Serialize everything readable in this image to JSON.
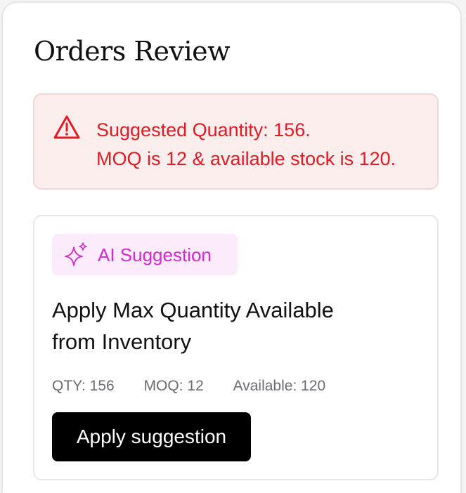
{
  "page": {
    "title": "Orders Review"
  },
  "alert": {
    "icon": "warning-triangle-icon",
    "line1": "Suggested Quantity: 156.",
    "line2": "MOQ is 12 & available stock is 120.",
    "color": "#e31b23",
    "background": "#fdeeee"
  },
  "suggestion": {
    "badge": {
      "icon": "sparkle-icon",
      "label": "AI Suggestion",
      "color": "#d62ad1",
      "background": "#fcebfb"
    },
    "title_line1": "Apply Max Quantity Available",
    "title_line2": "from Inventory",
    "stats": {
      "qty": "QTY: 156",
      "moq": "MOQ: 12",
      "available": "Available: 120"
    },
    "apply_button_label": "Apply suggestion"
  }
}
